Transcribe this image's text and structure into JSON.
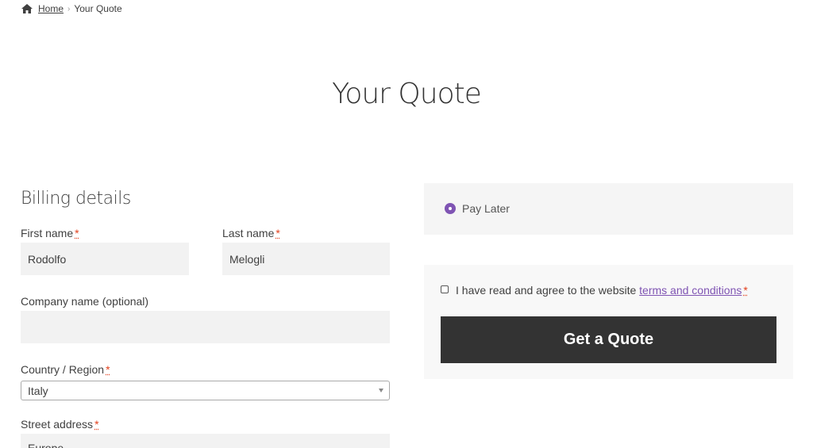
{
  "breadcrumb": {
    "home_icon": "home-icon",
    "home_label": "Home",
    "separator": "›",
    "current": "Your Quote"
  },
  "page": {
    "title": "Your Quote"
  },
  "billing": {
    "title": "Billing details",
    "required_marker": "*",
    "first_name": {
      "label": "First name",
      "value": "Rodolfo"
    },
    "last_name": {
      "label": "Last name",
      "value": "Melogli"
    },
    "company": {
      "label": "Company name (optional)",
      "value": ""
    },
    "country": {
      "label": "Country / Region",
      "value": "Italy"
    },
    "street": {
      "label": "Street address",
      "value": "Europe"
    }
  },
  "payment": {
    "option_label": "Pay Later",
    "selected": true
  },
  "terms": {
    "text": "I have read and agree to the website",
    "link": "terms and conditions",
    "required_marker": "*",
    "checked": false
  },
  "actions": {
    "submit_label": "Get a Quote"
  },
  "colors": {
    "accent": "#7f54b3",
    "button_bg": "#333333",
    "required": "#e2401c",
    "input_bg": "#f2f2f2"
  }
}
